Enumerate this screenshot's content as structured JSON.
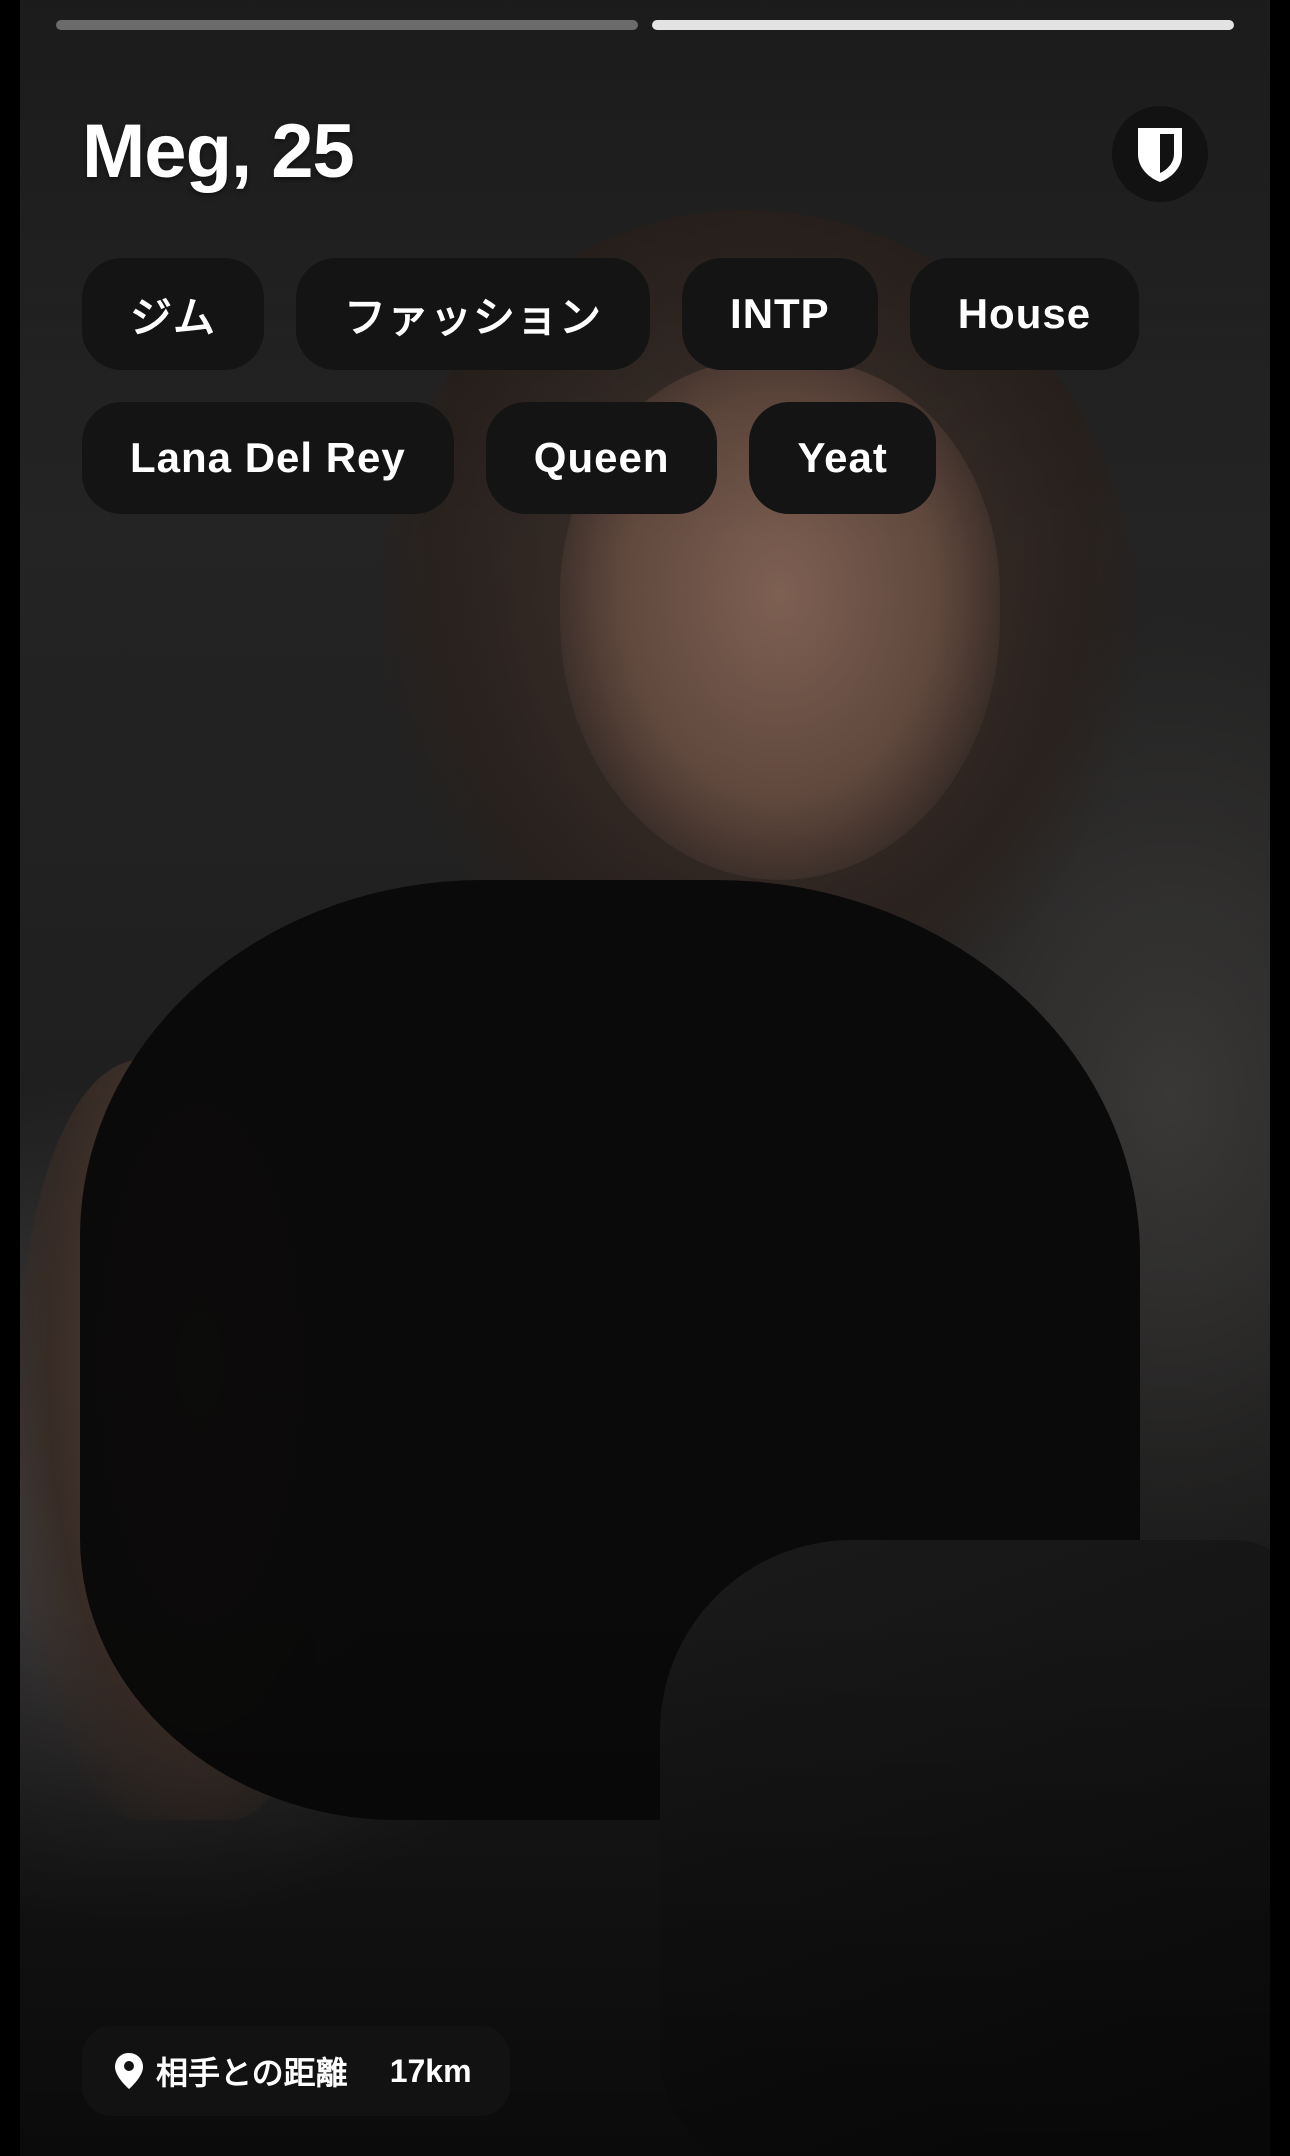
{
  "profile": {
    "name_age": "Meg, 25",
    "photo_count": 2,
    "active_photo_index": 2
  },
  "tags": {
    "row1": [
      "ジム",
      "ファッション",
      "INTP",
      "House"
    ],
    "row2": [
      "Lana Del Rey",
      "Queen",
      "Yeat"
    ]
  },
  "distance": {
    "label": "相手との距離",
    "value": "17km"
  },
  "icons": {
    "safety": "shield-icon",
    "location": "location-pin-icon"
  },
  "colors": {
    "tag_background": "#141414",
    "text": "#ffffff",
    "progress_active": "#e0e0e0",
    "progress_inactive": "#5a5a5a"
  }
}
